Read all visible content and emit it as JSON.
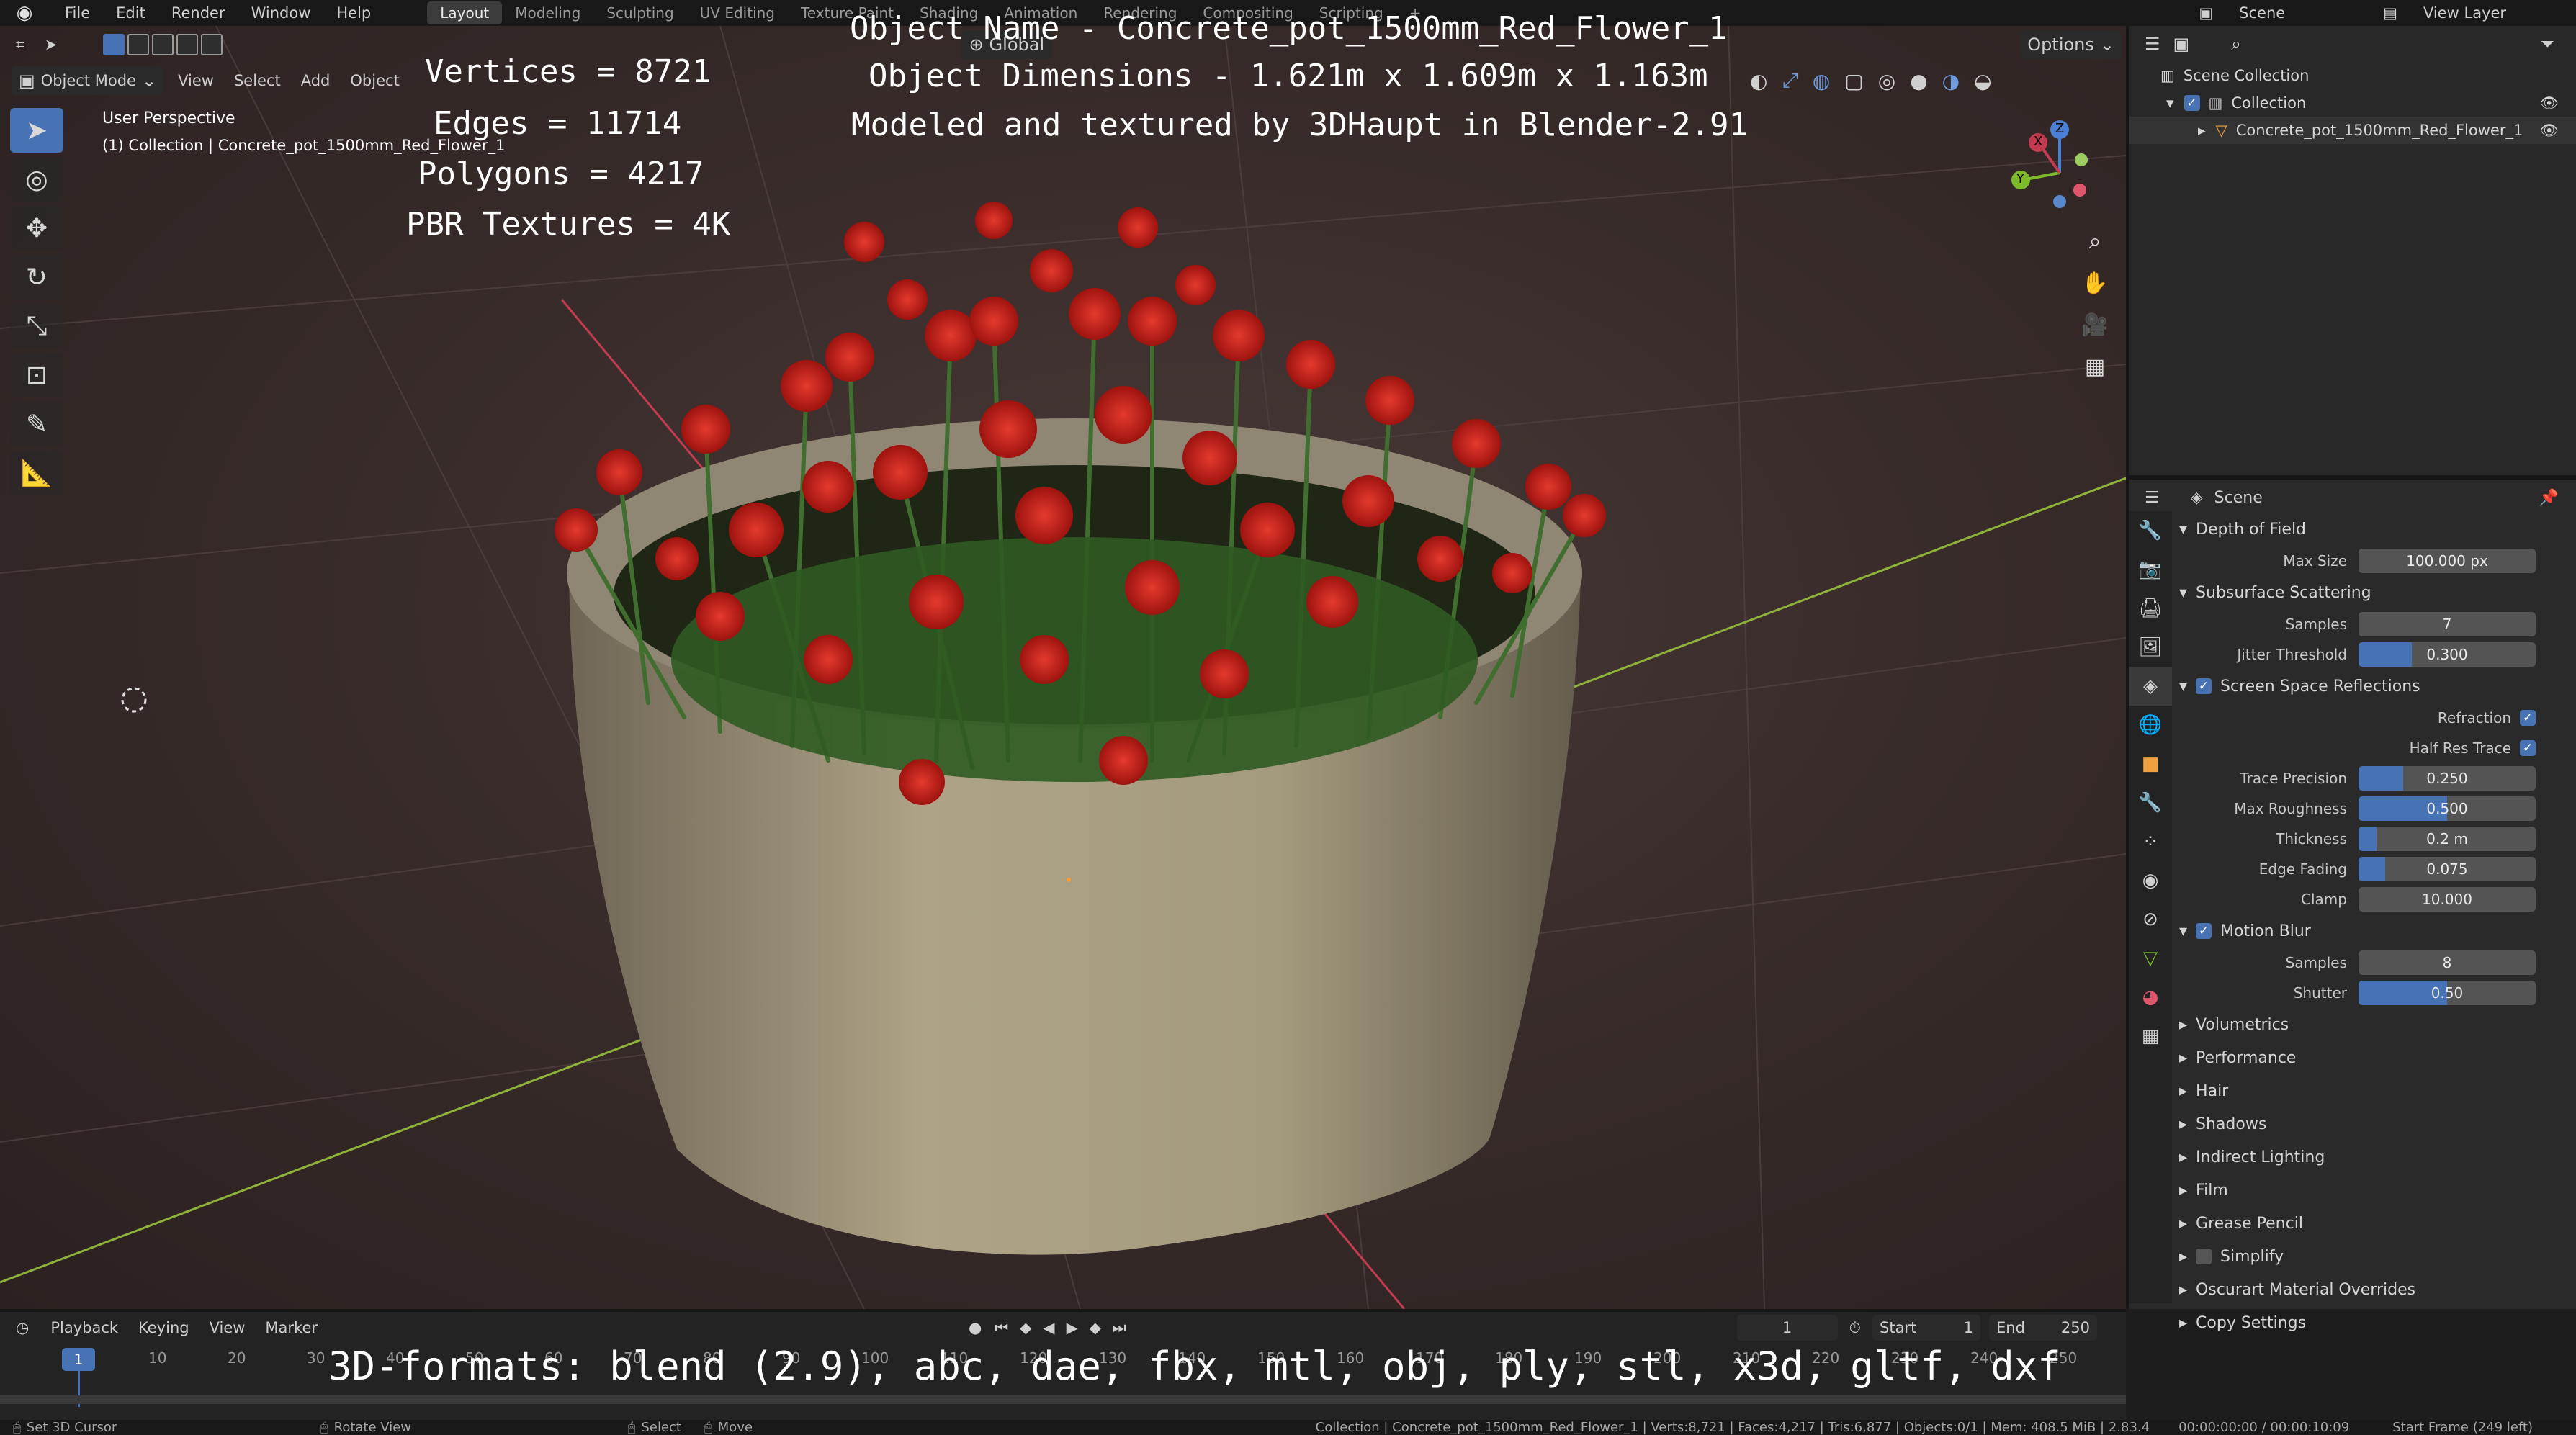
{
  "menubar": {
    "items": [
      "File",
      "Edit",
      "Render",
      "Window",
      "Help"
    ],
    "workspaces": [
      "Layout",
      "Modeling",
      "Sculpting",
      "UV Editing",
      "Texture Paint",
      "Shading",
      "Animation",
      "Rendering",
      "Compositing",
      "Scripting"
    ],
    "active_workspace": "Layout",
    "add_tab": "+",
    "scene_label": "Scene",
    "view_layer_label": "View Layer"
  },
  "viewport_header": {
    "mode": "Object Mode",
    "menus": [
      "View",
      "Select",
      "Add",
      "Object"
    ],
    "orientation": "Global",
    "options": "Options"
  },
  "viewport_info": {
    "perspective": "User Perspective",
    "collection": "(1) Collection | Concrete_pot_1500mm_Red_Flower_1"
  },
  "overlay_text": {
    "stats": [
      "Vertices = 8721",
      "Edges = 11714",
      "Polygons = 4217",
      "PBR Textures = 4K"
    ],
    "header": [
      "Object Name - Concrete_pot_1500mm_Red_Flower_1",
      "Object Dimensions -  1.621m x 1.609m x 1.163m",
      "Modeled and textured by 3DHaupt in Blender-2.91"
    ],
    "formats": "3D-formats: blend (2.9), abc, dae, fbx, mtl, obj, ply, stl, x3d, gltf, dxf"
  },
  "gizmo": {
    "x": "X",
    "y": "Y",
    "z": "Z"
  },
  "outliner": {
    "root": "Scene Collection",
    "collection": "Collection",
    "object": "Concrete_pot_1500mm_Red_Flower_1"
  },
  "properties": {
    "context": "Scene",
    "sections": [
      {
        "title": "Depth of Field",
        "fields": [
          {
            "label": "Max Size",
            "value": "100.000 px",
            "fill": 0
          }
        ]
      },
      {
        "title": "Subsurface Scattering",
        "fields": [
          {
            "label": "Samples",
            "value": "7",
            "fill": 0
          },
          {
            "label": "Jitter Threshold",
            "value": "0.300",
            "fill": 0.3
          }
        ]
      },
      {
        "title": "Screen Space Reflections",
        "checked": true,
        "checks": [
          {
            "label": "Refraction",
            "checked": true
          },
          {
            "label": "Half Res Trace",
            "checked": true
          }
        ],
        "fields": [
          {
            "label": "Trace Precision",
            "value": "0.250",
            "fill": 0.25
          },
          {
            "label": "Max Roughness",
            "value": "0.500",
            "fill": 0.5
          },
          {
            "label": "Thickness",
            "value": "0.2 m",
            "fill": 0.1
          },
          {
            "label": "Edge Fading",
            "value": "0.075",
            "fill": 0.15
          },
          {
            "label": "Clamp",
            "value": "10.000",
            "fill": 0
          }
        ]
      },
      {
        "title": "Motion Blur",
        "checked": true,
        "fields": [
          {
            "label": "Samples",
            "value": "8",
            "fill": 0
          },
          {
            "label": "Shutter",
            "value": "0.50",
            "fill": 0.5
          }
        ]
      }
    ],
    "collapsed": [
      "Volumetrics",
      "Performance",
      "Hair",
      "Shadows",
      "Indirect Lighting",
      "Film",
      "Grease Pencil",
      "Simplify",
      "Oscurart Material Overrides",
      "Copy Settings"
    ]
  },
  "timeline": {
    "menus": [
      "Playback",
      "Keying",
      "View",
      "Marker"
    ],
    "current_frame": "1",
    "start_label": "Start",
    "start": "1",
    "end_label": "End",
    "end": "250",
    "ticks": [
      "10",
      "20",
      "30",
      "40",
      "50",
      "60",
      "70",
      "80",
      "90",
      "100",
      "110",
      "120",
      "130",
      "140",
      "150",
      "160",
      "170",
      "180",
      "190",
      "200",
      "210",
      "220",
      "230",
      "240",
      "250"
    ]
  },
  "statusbar": {
    "hints": [
      "Set 3D Cursor",
      "Rotate View",
      "Select",
      "Move"
    ],
    "info": "Collection | Concrete_pot_1500mm_Red_Flower_1 | Verts:8,721 | Faces:4,217 | Tris:6,877 | Objects:0/1 | Mem: 408.5 MiB | 2.83.4",
    "time": "00:00:00:00 / 00:00:10:09",
    "start_frame": "Start Frame (249 left)"
  },
  "colors": {
    "accent": "#4772b3",
    "flower": "#c7201c",
    "pot": "#a69c7e",
    "grid_x": "#8fb33a",
    "grid_y": "#c23b50"
  }
}
